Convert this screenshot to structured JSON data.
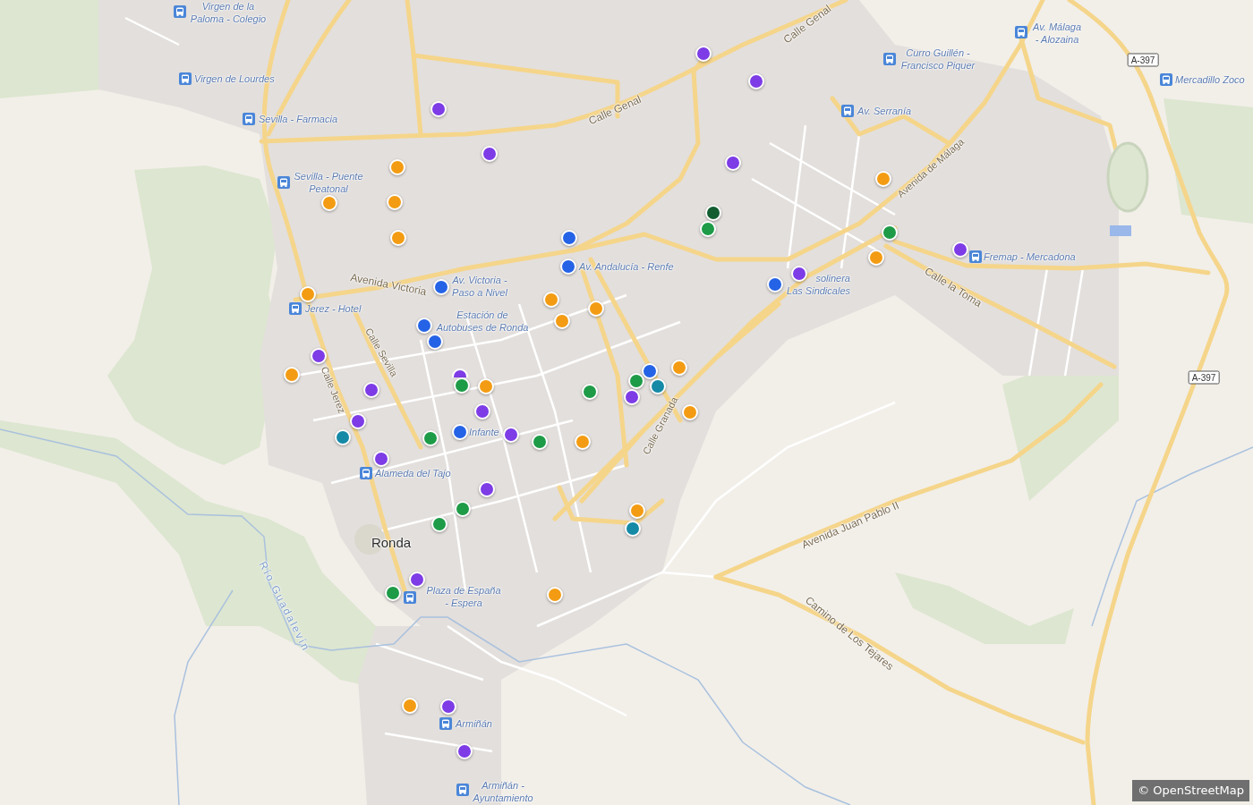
{
  "map": {
    "street_labels": [
      {
        "text": "Calle Genal"
      },
      {
        "text": "Calle Genal"
      },
      {
        "text": "Avenida de Málaga"
      },
      {
        "text": "Avenida Victoria"
      },
      {
        "text": "Calle la Toma"
      },
      {
        "text": "Calle Jerez"
      },
      {
        "text": "Calle Sevilla"
      },
      {
        "text": "Calle Granada"
      },
      {
        "text": "Avenida Juan Pablo II"
      },
      {
        "text": "Camino de Los Tejares"
      }
    ],
    "river_label": "Río Guadalevín",
    "place_label": "Ronda",
    "road_shields": [
      "A-397",
      "A-397"
    ],
    "bus_stops": [
      {
        "lines": [
          "Virgen de la",
          "Paloma - Colegio"
        ]
      },
      {
        "lines": [
          "Av. Málaga",
          "- Alozaina"
        ]
      },
      {
        "lines": [
          "Curro Guillén -",
          "Francisco Piquer"
        ]
      },
      {
        "lines": [
          "Virgen de Lourdes"
        ]
      },
      {
        "lines": [
          "Mercadillo Zoco"
        ]
      },
      {
        "lines": [
          "Sevilla - Farmacia"
        ]
      },
      {
        "lines": [
          "Av. Serranía"
        ]
      },
      {
        "lines": [
          "Sevilla - Puente",
          "Peatonal"
        ]
      },
      {
        "lines": [
          "Av. Andalucía - Renfe"
        ]
      },
      {
        "lines": [
          "Fremap - Mercadona"
        ]
      },
      {
        "lines": [
          "Av. Victoria -",
          "Paso a Nivel"
        ]
      },
      {
        "lines": [
          "solinera",
          "Las Sindicales"
        ]
      },
      {
        "lines": [
          "Jerez - Hotel"
        ]
      },
      {
        "lines": [
          "Estación de",
          "Autobuses de Ronda"
        ]
      },
      {
        "lines": [
          "Infante"
        ]
      },
      {
        "lines": [
          "Alameda del Tajo"
        ]
      },
      {
        "lines": [
          "Plaza de España",
          "- Espera"
        ]
      },
      {
        "lines": [
          "Armiñán"
        ]
      },
      {
        "lines": [
          "Armiñán -",
          "Ayuntamiento"
        ]
      }
    ]
  },
  "markers": [
    {
      "color": "#7d3ce6"
    },
    {
      "color": "#7d3ce6"
    },
    {
      "color": "#7d3ce6"
    },
    {
      "color": "#7d3ce6"
    },
    {
      "color": "#f39c13"
    },
    {
      "color": "#7d3ce6"
    },
    {
      "color": "#f39c13"
    },
    {
      "color": "#f39c13"
    },
    {
      "color": "#f39c13"
    },
    {
      "color": "#135e31"
    },
    {
      "color": "#1e9b47"
    },
    {
      "color": "#1e9b47"
    },
    {
      "color": "#f39c13"
    },
    {
      "color": "#2563e6"
    },
    {
      "color": "#7d3ce6"
    },
    {
      "color": "#f39c13"
    },
    {
      "color": "#2563e6"
    },
    {
      "color": "#7d3ce6"
    },
    {
      "color": "#2563e6"
    },
    {
      "color": "#2563e6"
    },
    {
      "color": "#f39c13"
    },
    {
      "color": "#f39c13"
    },
    {
      "color": "#f39c13"
    },
    {
      "color": "#f39c13"
    },
    {
      "color": "#2563e6"
    },
    {
      "color": "#2563e6"
    },
    {
      "color": "#7d3ce6"
    },
    {
      "color": "#f39c13"
    },
    {
      "color": "#f39c13"
    },
    {
      "color": "#2563e6"
    },
    {
      "color": "#7d3ce6"
    },
    {
      "color": "#1e9b47"
    },
    {
      "color": "#158aa6"
    },
    {
      "color": "#1e9b47"
    },
    {
      "color": "#f39c13"
    },
    {
      "color": "#7d3ce6"
    },
    {
      "color": "#1e9b47"
    },
    {
      "color": "#7d3ce6"
    },
    {
      "color": "#7d3ce6"
    },
    {
      "color": "#f39c13"
    },
    {
      "color": "#7d3ce6"
    },
    {
      "color": "#2563e6"
    },
    {
      "color": "#7d3ce6"
    },
    {
      "color": "#158aa6"
    },
    {
      "color": "#1e9b47"
    },
    {
      "color": "#1e9b47"
    },
    {
      "color": "#f39c13"
    },
    {
      "color": "#7d3ce6"
    },
    {
      "color": "#7d3ce6"
    },
    {
      "color": "#1e9b47"
    },
    {
      "color": "#f39c13"
    },
    {
      "color": "#1e9b47"
    },
    {
      "color": "#158aa6"
    },
    {
      "color": "#7d3ce6"
    },
    {
      "color": "#1e9b47"
    },
    {
      "color": "#f39c13"
    },
    {
      "color": "#f39c13"
    },
    {
      "color": "#7d3ce6"
    },
    {
      "color": "#7d3ce6"
    }
  ],
  "attribution": "© OpenStreetMap"
}
